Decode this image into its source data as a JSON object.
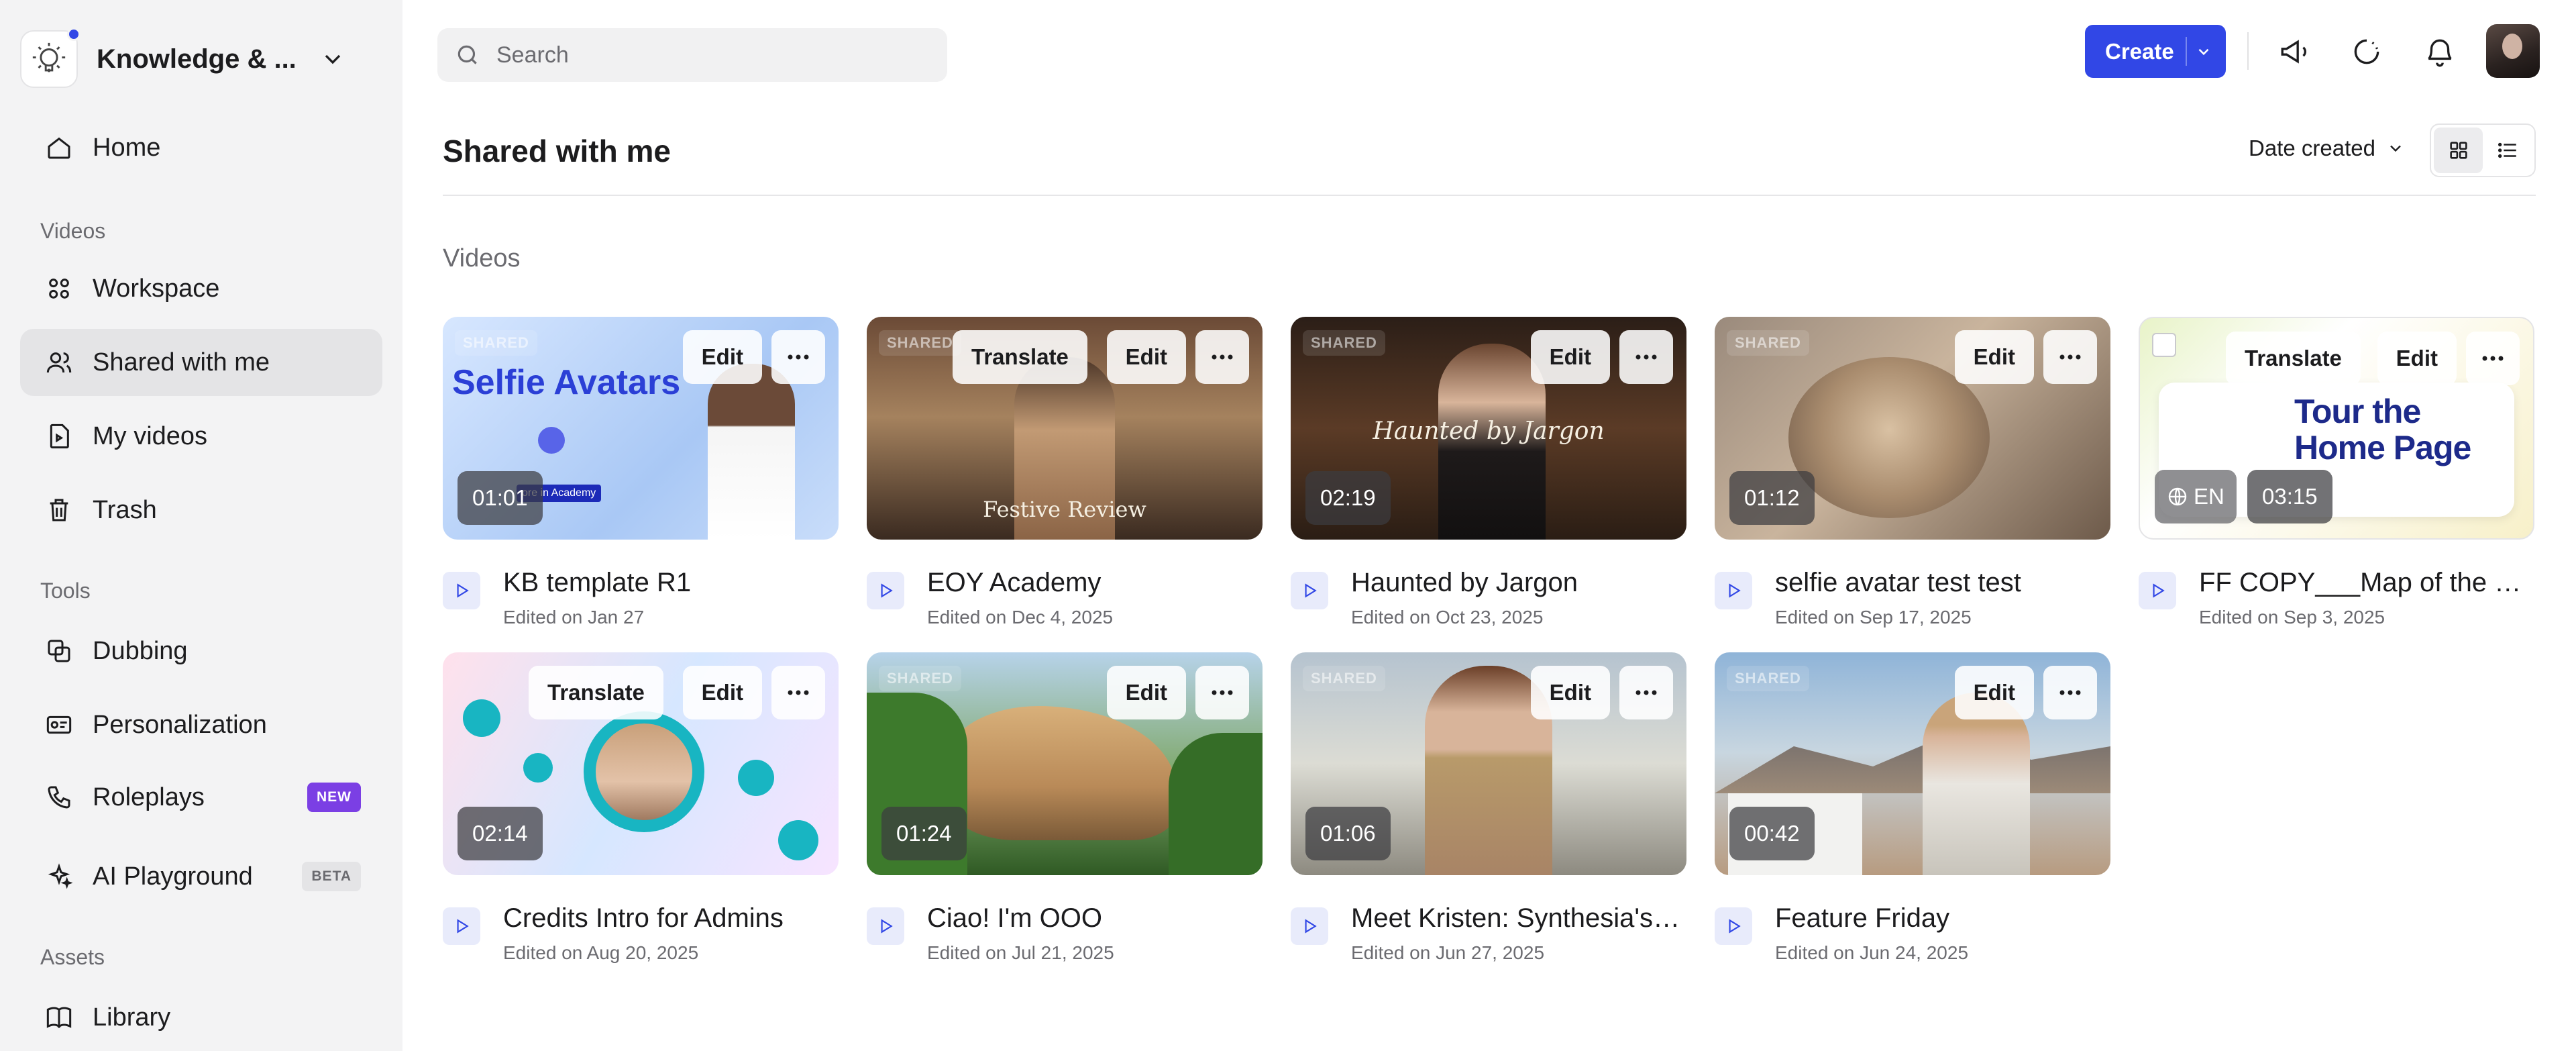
{
  "workspace": {
    "name": "Knowledge & ..."
  },
  "sidebar": {
    "home": "Home",
    "sections": {
      "videos": "Videos",
      "tools": "Tools",
      "assets": "Assets"
    },
    "items": {
      "workspace": "Workspace",
      "shared": "Shared with me",
      "my_videos": "My videos",
      "trash": "Trash",
      "dubbing": "Dubbing",
      "personalization": "Personalization",
      "roleplays": "Roleplays",
      "ai_playground": "AI Playground",
      "library": "Library"
    },
    "badges": {
      "new": "NEW",
      "beta": "BETA"
    }
  },
  "topbar": {
    "search_placeholder": "Search",
    "create_label": "Create"
  },
  "header": {
    "title": "Shared with me",
    "sort_label": "Date created",
    "view": "grid"
  },
  "section": {
    "title": "Videos"
  },
  "cards": [
    {
      "title": "KB template R1",
      "edited": "Edited on Jan 27",
      "duration": "01:01",
      "shared": "SHARED",
      "buttons": [
        "Edit"
      ],
      "thumb_text": "Selfie Avatars",
      "thumb_sub": "ore in Academy"
    },
    {
      "title": "EOY Academy",
      "edited": "Edited on Dec 4, 2025",
      "duration": "",
      "shared": "SHARED",
      "buttons": [
        "Translate",
        "Edit"
      ],
      "thumb_text": "Festive Review"
    },
    {
      "title": "Haunted by Jargon",
      "edited": "Edited on Oct 23, 2025",
      "duration": "02:19",
      "shared": "SHARED",
      "buttons": [
        "Edit"
      ],
      "thumb_text": "Haunted by Jargon"
    },
    {
      "title": "selfie avatar test test",
      "edited": "Edited on Sep 17, 2025",
      "duration": "01:12",
      "shared": "SHARED",
      "buttons": [
        "Edit"
      ]
    },
    {
      "title": "FF COPY___Map of the Home Page",
      "edited": "Edited on Sep 3, 2025",
      "duration": "03:15",
      "lang": "EN",
      "buttons": [
        "Translate",
        "Edit"
      ],
      "thumb_text": "Tour the Home Page"
    },
    {
      "title": "Credits Intro for Admins",
      "edited": "Edited on Aug 20, 2025",
      "duration": "02:14",
      "buttons": [
        "Translate",
        "Edit"
      ]
    },
    {
      "title": "Ciao! I'm OOO",
      "edited": "Edited on Jul 21, 2025",
      "duration": "01:24",
      "shared": "SHARED",
      "buttons": [
        "Edit"
      ]
    },
    {
      "title": "Meet Kristen: Synthesia's New Avatar",
      "edited": "Edited on Jun 27, 2025",
      "duration": "01:06",
      "shared": "SHARED",
      "buttons": [
        "Edit"
      ]
    },
    {
      "title": "Feature Friday",
      "edited": "Edited on Jun 24, 2025",
      "duration": "00:42",
      "shared": "SHARED",
      "buttons": [
        "Edit"
      ]
    }
  ],
  "icons": {
    "search": "search-icon",
    "announce": "megaphone-icon",
    "loading": "spinner-icon",
    "notifications": "bell-icon",
    "grid": "grid-view-icon",
    "list": "list-view-icon"
  },
  "colors": {
    "accent": "#3147e6",
    "badge_new": "#7b3fe4",
    "sidebar_bg": "#f3f3f4"
  }
}
